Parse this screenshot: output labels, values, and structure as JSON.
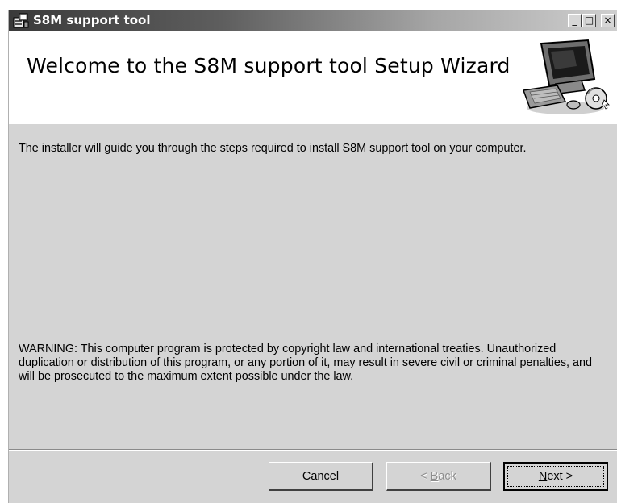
{
  "window": {
    "title": "S8M support tool",
    "controls": {
      "minimize": "_",
      "maximize": "□",
      "close": "×"
    }
  },
  "banner": {
    "title": "Welcome to the S8M support tool Setup Wizard",
    "icon": "computer-setup-icon"
  },
  "body": {
    "intro": "The installer will guide you through the steps required to install S8M support tool on your computer.",
    "warning": "WARNING: This computer program is protected by copyright law and international treaties. Unauthorized duplication or distribution of this program, or any portion of it, may result in severe civil or criminal penalties, and will be prosecuted to the maximum extent possible under the law."
  },
  "buttons": {
    "cancel": {
      "label": "Cancel",
      "enabled": true
    },
    "back": {
      "prefix": "< ",
      "mnemonic": "B",
      "rest": "ack",
      "enabled": false
    },
    "next": {
      "mnemonic": "N",
      "rest": "ext",
      "suffix": " >",
      "enabled": true,
      "default": true
    }
  }
}
